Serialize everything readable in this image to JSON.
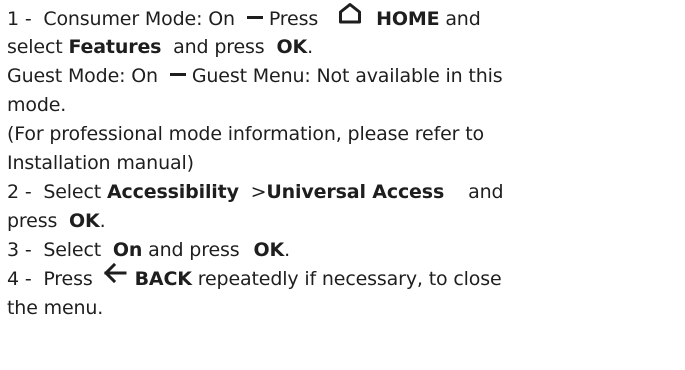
{
  "steps": {
    "s1": {
      "num": "1 -",
      "t1": "Consumer Mode: On",
      "t2": "Press",
      "home": "HOME",
      "t3": "and",
      "t4": "select",
      "features": "Features",
      "t5": "and press",
      "ok": "OK",
      "t6": ".",
      "g1": "Guest Mode: On",
      "g2": "Guest Menu: Not available in this",
      "g3": "mode.",
      "p1": "(For professional mode information, please refer to",
      "p2": "Installation manual)"
    },
    "s2": {
      "num": "2 -",
      "t1": "Select",
      "accessibility": "Accessibility",
      "gt": ">",
      "universal": "Universal Access",
      "t2": "and",
      "t3": "press",
      "ok": "OK",
      "t4": "."
    },
    "s3": {
      "num": "3 -",
      "t1": "Select",
      "on": "On",
      "t2": "and press",
      "ok": "OK",
      "t3": "."
    },
    "s4": {
      "num": "4 -",
      "t1": "Press",
      "back": "BACK",
      "t2": "repeatedly if necessary, to close",
      "t3": "the menu."
    }
  },
  "icons": {
    "home": "home-icon",
    "back": "arrow-left-icon",
    "dash": "dash-icon"
  }
}
